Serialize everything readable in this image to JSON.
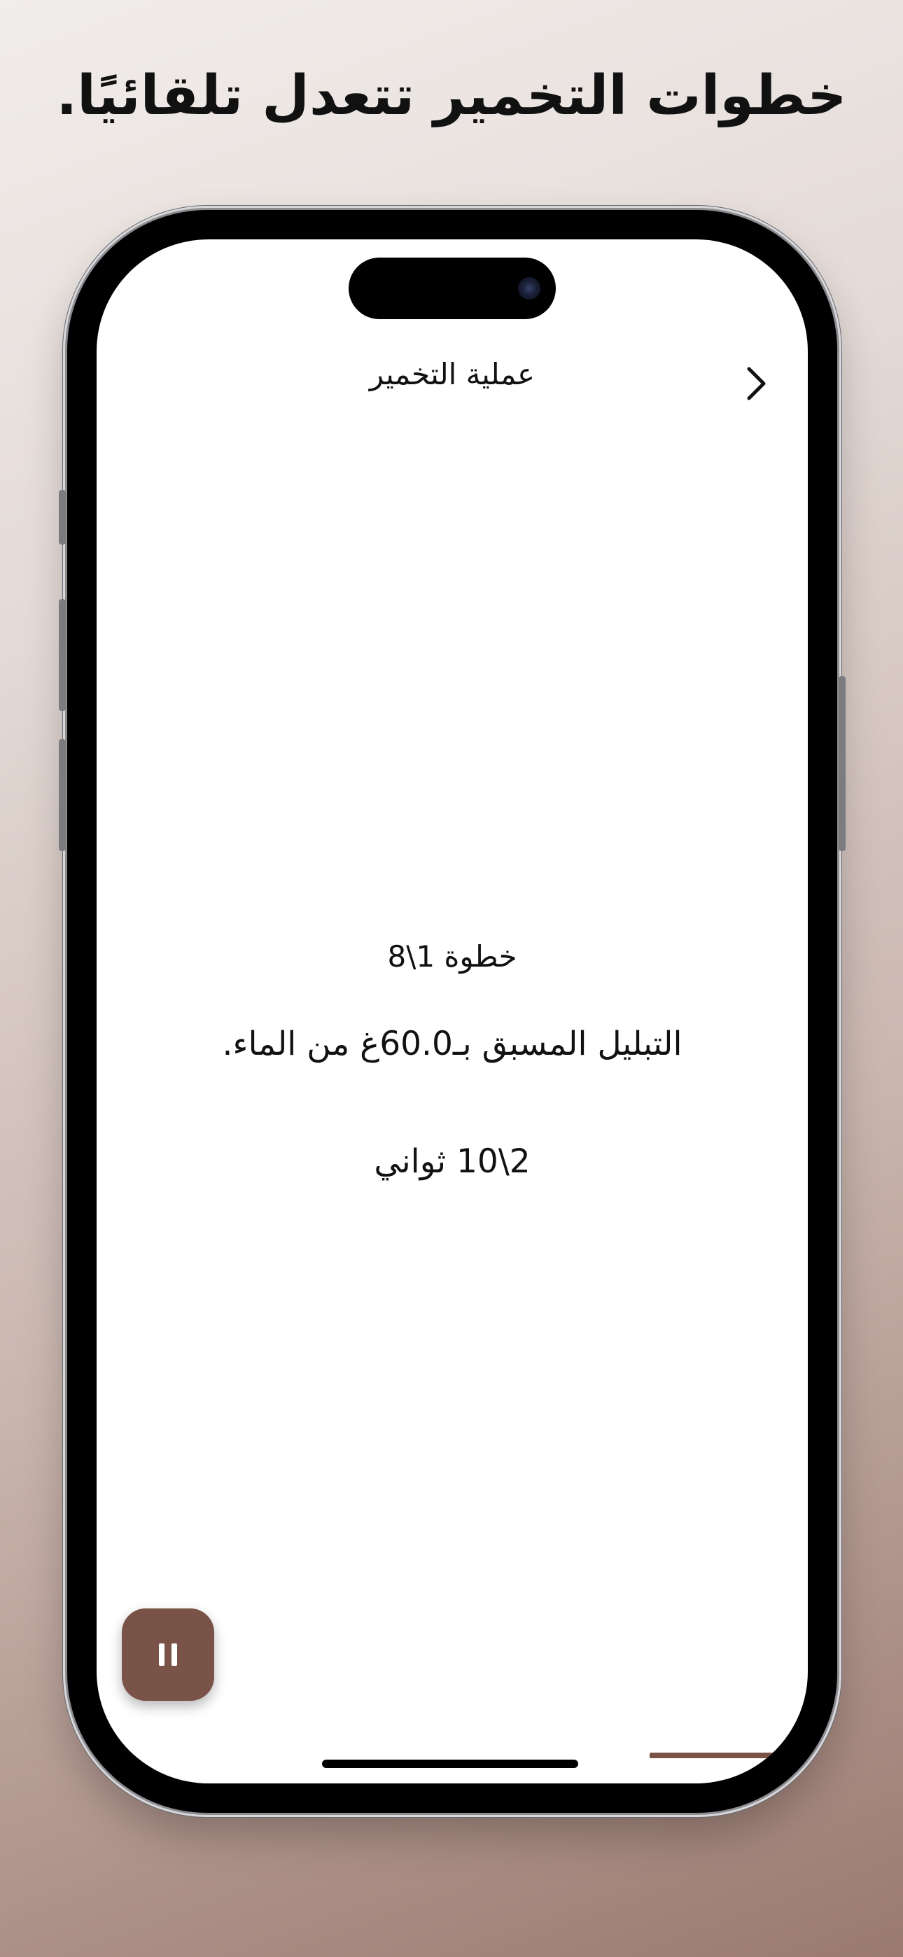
{
  "headline": "خطوات التخمير تتعدل تلقائيًا.",
  "nav": {
    "title": "عملية التخمير",
    "chevron_icon": "chevron-right-icon"
  },
  "step": {
    "counter": "خطوة 1\\8",
    "instruction": "التبليل المسبق بـ60.0غ من الماء.",
    "timer": "2\\10 ثواني"
  },
  "controls": {
    "pause_icon": "pause-icon",
    "accent_color": "#7a5348",
    "progress_fraction": 0.2
  }
}
